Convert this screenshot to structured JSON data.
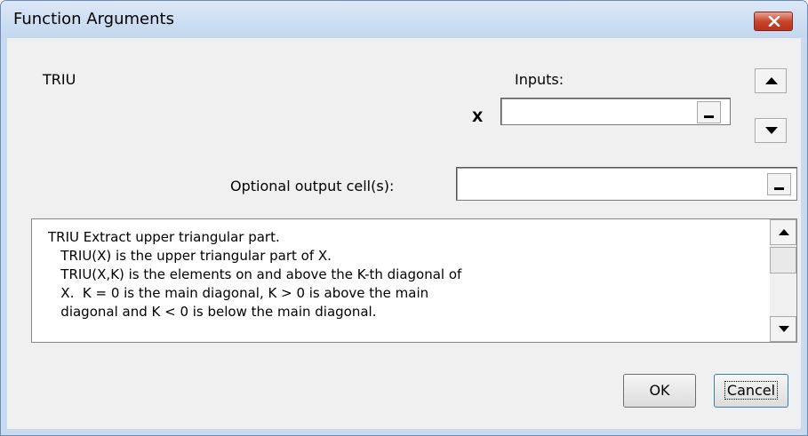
{
  "window": {
    "title": "Function Arguments"
  },
  "function": {
    "name": "TRIU"
  },
  "inputs": {
    "heading": "Inputs:",
    "args": [
      {
        "label": "X",
        "value": ""
      }
    ]
  },
  "output": {
    "label": "Optional output cell(s):",
    "value": ""
  },
  "description": {
    "lines": [
      "TRIU Extract upper triangular part.",
      "   TRIU(X) is the upper triangular part of X.",
      "   TRIU(X,K) is the elements on and above the K-th diagonal of",
      "   X.  K = 0 is the main diagonal, K > 0 is above the main",
      "   diagonal and K < 0 is below the main diagonal."
    ]
  },
  "buttons": {
    "ok": "OK",
    "cancel": "Cancel"
  }
}
